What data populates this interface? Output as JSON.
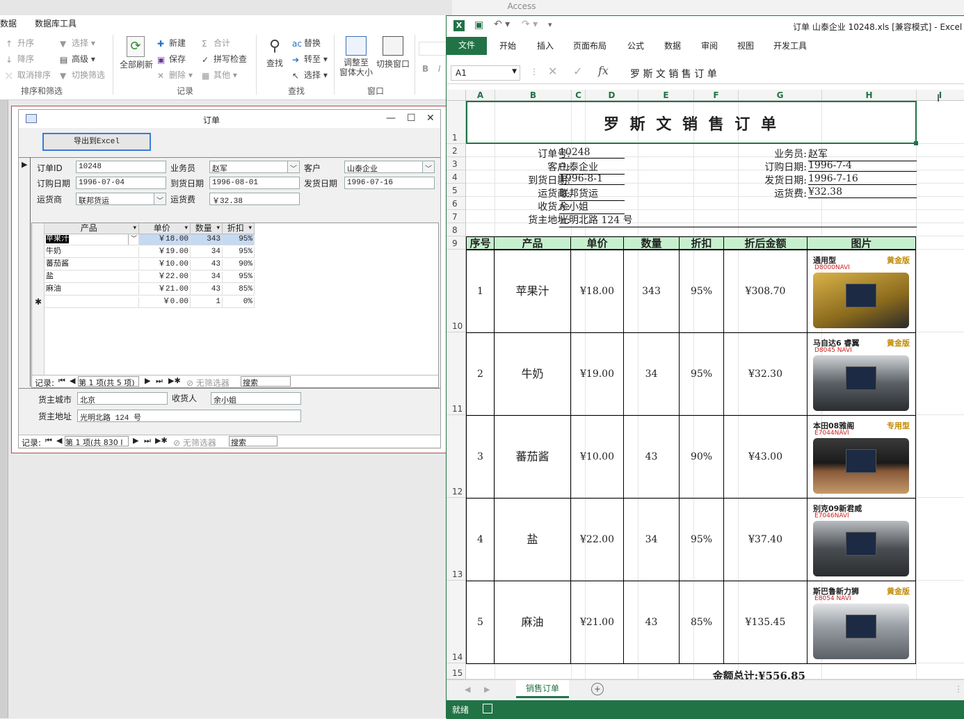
{
  "access": {
    "title": "Access",
    "tabs": [
      "数据",
      "数据库工具"
    ],
    "ribbon": {
      "sort_group": {
        "label": "排序和筛选",
        "asc": "升序",
        "desc": "降序",
        "clear_sort": "取消排序",
        "select": "选择",
        "advanced": "高级",
        "toggle_filter": "切换筛选"
      },
      "records_group": {
        "label": "记录",
        "refresh_all": "全部刷新",
        "new": "新建",
        "save": "保存",
        "delete": "删除",
        "sum": "合计",
        "spell": "拼写检查",
        "more": "其他"
      },
      "find_group": {
        "label": "查找",
        "find": "查找",
        "replace": "替换",
        "goto": "转至",
        "select": "选择"
      },
      "window_group": {
        "label": "窗口",
        "fit": "调整至窗体大小",
        "fit_line1": "调整至",
        "fit_line2": "窗体大小",
        "switch": "切换窗口"
      },
      "text_group": {
        "bold": "B",
        "italic": "I"
      }
    },
    "form": {
      "title": "订单",
      "export_button": "导出到Excel",
      "fields": {
        "order_id_label": "订单ID",
        "order_id": "10248",
        "employee_label": "业务员",
        "employee": "赵军",
        "customer_label": "客户",
        "customer": "山泰企业",
        "order_date_label": "订购日期",
        "order_date": "1996-07-04",
        "required_date_label": "到货日期",
        "required_date": "1996-08-01",
        "shipped_date_label": "发货日期",
        "shipped_date": "1996-07-16",
        "shipper_label": "运货商",
        "shipper": "联邦货运",
        "freight_label": "运货费",
        "freight": "￥32.38",
        "city_label": "货主城市",
        "city": "北京",
        "recipient_label": "收货人",
        "recipient": "余小姐",
        "address_label": "货主地址",
        "address": "光明北路 124 号"
      },
      "subform": {
        "columns": [
          "产品",
          "单价",
          "数量",
          "折扣"
        ],
        "rows": [
          {
            "product": "苹果汁",
            "price": "￥18.00",
            "qty": "343",
            "disc": "95%"
          },
          {
            "product": "牛奶",
            "price": "￥19.00",
            "qty": "34",
            "disc": "95%"
          },
          {
            "product": "蕃茄酱",
            "price": "￥10.00",
            "qty": "43",
            "disc": "90%"
          },
          {
            "product": "盐",
            "price": "￥22.00",
            "qty": "34",
            "disc": "95%"
          },
          {
            "product": "麻油",
            "price": "￥21.00",
            "qty": "43",
            "disc": "85%"
          }
        ],
        "new_row": {
          "marker": "✱",
          "price": "￥0.00",
          "qty": "1",
          "disc": "0%"
        },
        "nav": {
          "label": "记录:",
          "position": "第 1 项(共 5 项)",
          "filter": "无筛选器",
          "search": "搜索"
        }
      },
      "nav": {
        "label": "记录:",
        "position": "第 1 项(共 830 I",
        "filter": "无筛选器",
        "search": "搜索"
      }
    }
  },
  "excel": {
    "title": "订单 山泰企业 10248.xls  [兼容模式] - Excel",
    "menu": [
      "文件",
      "开始",
      "插入",
      "页面布局",
      "公式",
      "数据",
      "审阅",
      "视图",
      "开发工具"
    ],
    "name_box": "A1",
    "formula": "罗 斯 文 销 售 订 单",
    "columns": [
      "A",
      "B",
      "C",
      "D",
      "E",
      "F",
      "G",
      "H",
      "I"
    ],
    "rows": [
      "1",
      "2",
      "3",
      "4",
      "5",
      "6",
      "7",
      "8",
      "9",
      "10",
      "11",
      "12",
      "13",
      "14",
      "15"
    ],
    "sheet": {
      "title": "罗 斯 文 销 售 订 单",
      "order_no_label": "订单号:",
      "order_no": "10248",
      "customer_label": "客户:",
      "customer": "山泰企业",
      "arrival_label": "到货日期:",
      "arrival": "1996-8-1",
      "shipper_label": "运货商:",
      "shipper": "联邦货运",
      "recipient_label": "收货人:",
      "recipient": "余小姐",
      "address_label": "货主地址:",
      "address": "光明北路 124 号",
      "employee_label": "业务员:",
      "employee": "赵军",
      "order_date_label": "订购日期:",
      "order_date": "1996-7-4",
      "ship_date_label": "发货日期:",
      "ship_date": "1996-7-16",
      "freight_label": "运货费:",
      "freight": "¥32.38",
      "headers": [
        "序号",
        "产品",
        "单价",
        "数量",
        "折扣",
        "折后金额",
        "图片"
      ],
      "items": [
        {
          "no": "1",
          "product": "苹果汁",
          "price": "¥18.00",
          "qty": "343",
          "disc": "95%",
          "amount": "¥308.70",
          "img_title": "通用型",
          "img_badge": "黄金版",
          "img_code": "D8000NAVI"
        },
        {
          "no": "2",
          "product": "牛奶",
          "price": "¥19.00",
          "qty": "34",
          "disc": "95%",
          "amount": "¥32.30",
          "img_title": "马自达6 睿翼",
          "img_badge": "黄金版",
          "img_code": "D8045 NAVI"
        },
        {
          "no": "3",
          "product": "蕃茄酱",
          "price": "¥10.00",
          "qty": "43",
          "disc": "90%",
          "amount": "¥43.00",
          "img_title": "本田08雅阁",
          "img_badge": "专用型",
          "img_code": "E7044NAVI"
        },
        {
          "no": "4",
          "product": "盐",
          "price": "¥22.00",
          "qty": "34",
          "disc": "95%",
          "amount": "¥37.40",
          "img_title": "别克09新君威",
          "img_badge": "",
          "img_code": "E7046NAVI"
        },
        {
          "no": "5",
          "product": "麻油",
          "price": "¥21.00",
          "qty": "43",
          "disc": "85%",
          "amount": "¥135.45",
          "img_title": "斯巴鲁新力狮",
          "img_badge": "黄金版",
          "img_code": "E8054 NAVI"
        }
      ],
      "total": "金额总计:¥556.85"
    },
    "sheet_tab": "销售订单",
    "status": "就绪"
  }
}
